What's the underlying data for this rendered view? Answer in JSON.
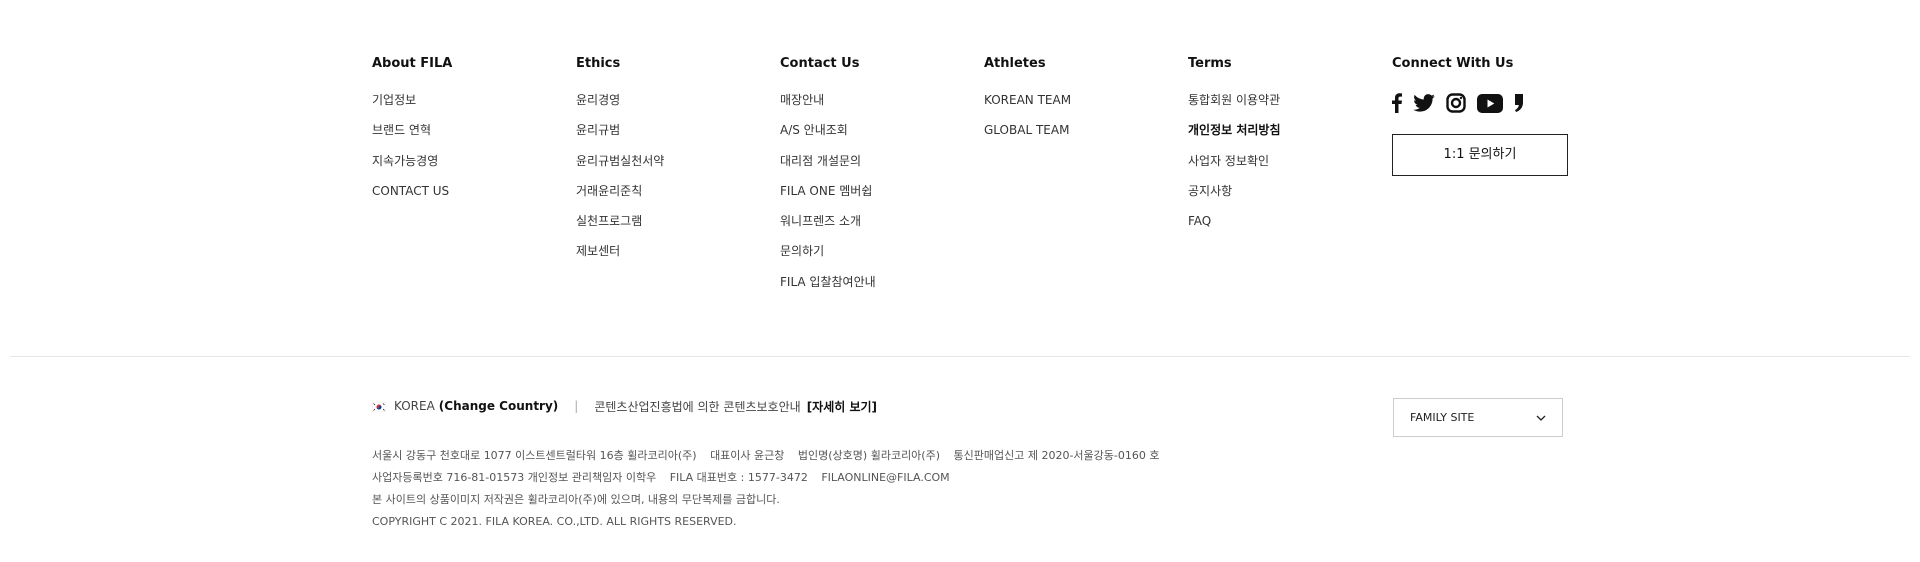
{
  "columns": [
    {
      "heading": "About FILA",
      "items": [
        "기업정보",
        "브랜드 연혁",
        "지속가능경영",
        "CONTACT US"
      ]
    },
    {
      "heading": "Ethics",
      "items": [
        "윤리경영",
        "윤리규범",
        "윤리규범실천서약",
        "거래윤리준칙",
        "실천프로그램",
        "제보센터"
      ]
    },
    {
      "heading": "Contact Us",
      "items": [
        "매장안내",
        "A/S 안내조회",
        "대리점 개설문의",
        "FILA ONE 멤버쉽",
        "워니프렌즈 소개",
        "문의하기",
        "FILA 입찰참여안내"
      ]
    },
    {
      "heading": "Athletes",
      "items": [
        "KOREAN TEAM",
        "GLOBAL TEAM"
      ]
    },
    {
      "heading": "Terms",
      "items": [
        "통합회원 이용약관",
        "개인정보 처리방침",
        "사업자 정보확인",
        "공지사항",
        "FAQ"
      ]
    },
    {
      "heading": "Connect With Us",
      "social_icons": [
        "facebook-icon",
        "twitter-icon",
        "instagram-icon",
        "youtube-icon",
        "blog-icon"
      ],
      "inquiry_button": "1:1 문의하기"
    }
  ],
  "bottom": {
    "country": "KOREA",
    "change_country": "(Change Country)",
    "separator": "|",
    "notice": "콘텐츠산업진흥법에 의한 콘텐츠보호안내",
    "more_link": "[자세히 보기]",
    "family_site": "FAMILY SITE"
  },
  "company_info": {
    "line1": [
      "서울시 강동구 천호대로 1077 이스트센트럴타워 16층 휠라코리아(주)",
      "대표이사 윤근창",
      "법인명(상호명) 휠라코리아(주)",
      "통신판매업신고 제 2020-서울강동-0160 호"
    ],
    "line2": [
      "사업자등록번호 716-81-01573 개인정보 관리책임자 이학우",
      "FILA 대표번호 : 1577-3472",
      "FILAONLINE@FILA.COM"
    ],
    "line3": "본 사이트의 상품이미지 저작권은 휠라코리아(주)에 있으며, 내용의 무단복제를 금합니다.",
    "line4": "COPYRIGHT C 2021. FILA KOREA. CO.,LTD. ALL RIGHTS RESERVED."
  },
  "colors": {
    "text": "#222222",
    "divider": "#e6e6e6",
    "border": "#cccccc"
  }
}
